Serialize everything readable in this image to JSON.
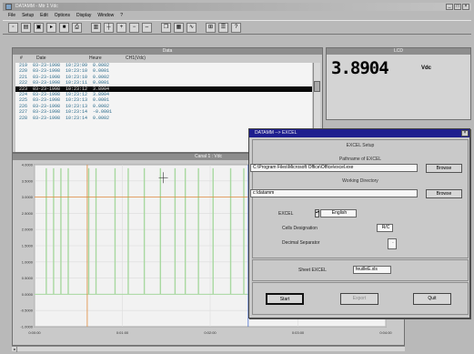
{
  "app": {
    "title": "DATAMM - Mtr 1 Vdc",
    "window_controls": [
      "_",
      "□",
      "×"
    ]
  },
  "menu": [
    "File",
    "Setup",
    "Edit",
    "Options",
    "Display",
    "Window",
    "?"
  ],
  "toolbar": {
    "icons": [
      "new-icon",
      "open-icon",
      "save-icon",
      "play-icon",
      "stop-icon",
      "print-icon",
      "chart-icon",
      "cursor-icon",
      "zoom-in-icon",
      "zoom-out-icon",
      "fit-icon",
      "copy-icon",
      "paste-icon",
      "graph-icon",
      "scale-icon",
      "settings-icon",
      "help-icon"
    ]
  },
  "data_panel": {
    "title": "Data",
    "columns": [
      "#",
      "Date",
      "Heure",
      "CH1(Vdc)"
    ],
    "rows": [
      "219  03-23-1998  10:23:09  0.0002",
      "220  03-23-1998  10:23:10  0.0001",
      "221  03-23-1998  10:23:10  0.0002",
      "222  03-23-1998  10:23:11  0.0001",
      "223  03-23-1998  10:23:12  3.8904",
      "224  03-23-1998  10:23:12  3.8904",
      "225  03-23-1998  10:23:13  0.0001",
      "226  03-23-1998  10:23:13  0.0002",
      "227  03-23-1998  10:23:14  -0.0001",
      "228  03-23-1998  10:23:14  0.0002"
    ],
    "selected_row": 4
  },
  "lcd_panel": {
    "title": "LCD",
    "value": "3.8904",
    "unit": "Vdc"
  },
  "chart_panel": {
    "title": "Canal 1 : Vdc"
  },
  "chart_data": {
    "type": "line",
    "title": "Canal 1 : Vdc",
    "x_ticks": [
      "0:00:00",
      "0:01:00",
      "0:02:00",
      "0:03:00",
      "0:04:00"
    ],
    "y_ticks": [
      "4.0000",
      "3.5000",
      "3.0000",
      "2.5000",
      "2.0000",
      "1.5000",
      "1.0000",
      "0.5000",
      "0.0000",
      "-0.5000",
      "-1.0000"
    ],
    "ylim": [
      -1.0,
      4.0
    ],
    "xlim": [
      0,
      240
    ],
    "baseline": 0.0,
    "peak_value": 3.89,
    "pulse_times": [
      8,
      13,
      18,
      23,
      37,
      42,
      55,
      64,
      75,
      86,
      96,
      103,
      112,
      122,
      134,
      143,
      150,
      156,
      166,
      176
    ],
    "h_cursor_value": 3.0,
    "v_cursors": [
      36,
      146
    ],
    "grid": true,
    "colors": {
      "signal": "#a8d8a0",
      "h_cursor": "#e08a3a",
      "v_cursor1": "#e08a3a",
      "v_cursor2": "#4a6fd0",
      "plot_bg": "#f2f2f2"
    }
  },
  "dialog": {
    "title": "DATAMM --> EXCEL",
    "close_label": "×",
    "section_title": "EXCEL Setup",
    "pathname_label": "Pathname of EXCEL",
    "pathname_value": "C:\\Program Files\\Microsoft Office\\Office\\excel.exe",
    "browse_label": "Browse",
    "workdir_label": "Working Directory",
    "workdir_value": "c:\\datamm",
    "browse2_label": "Browse",
    "excel_label": "EXCEL",
    "excel_value": "English",
    "cells_label": "Cells Designation",
    "cells_value": "R/C",
    "decimal_label": "Decimal Separator",
    "decimal_value": ".",
    "sheet_label": "Sheet EXCEL",
    "sheet_value": "feuilleE.xls",
    "start_label": "Start",
    "export_label": "Export",
    "quit_label": "Quit"
  }
}
